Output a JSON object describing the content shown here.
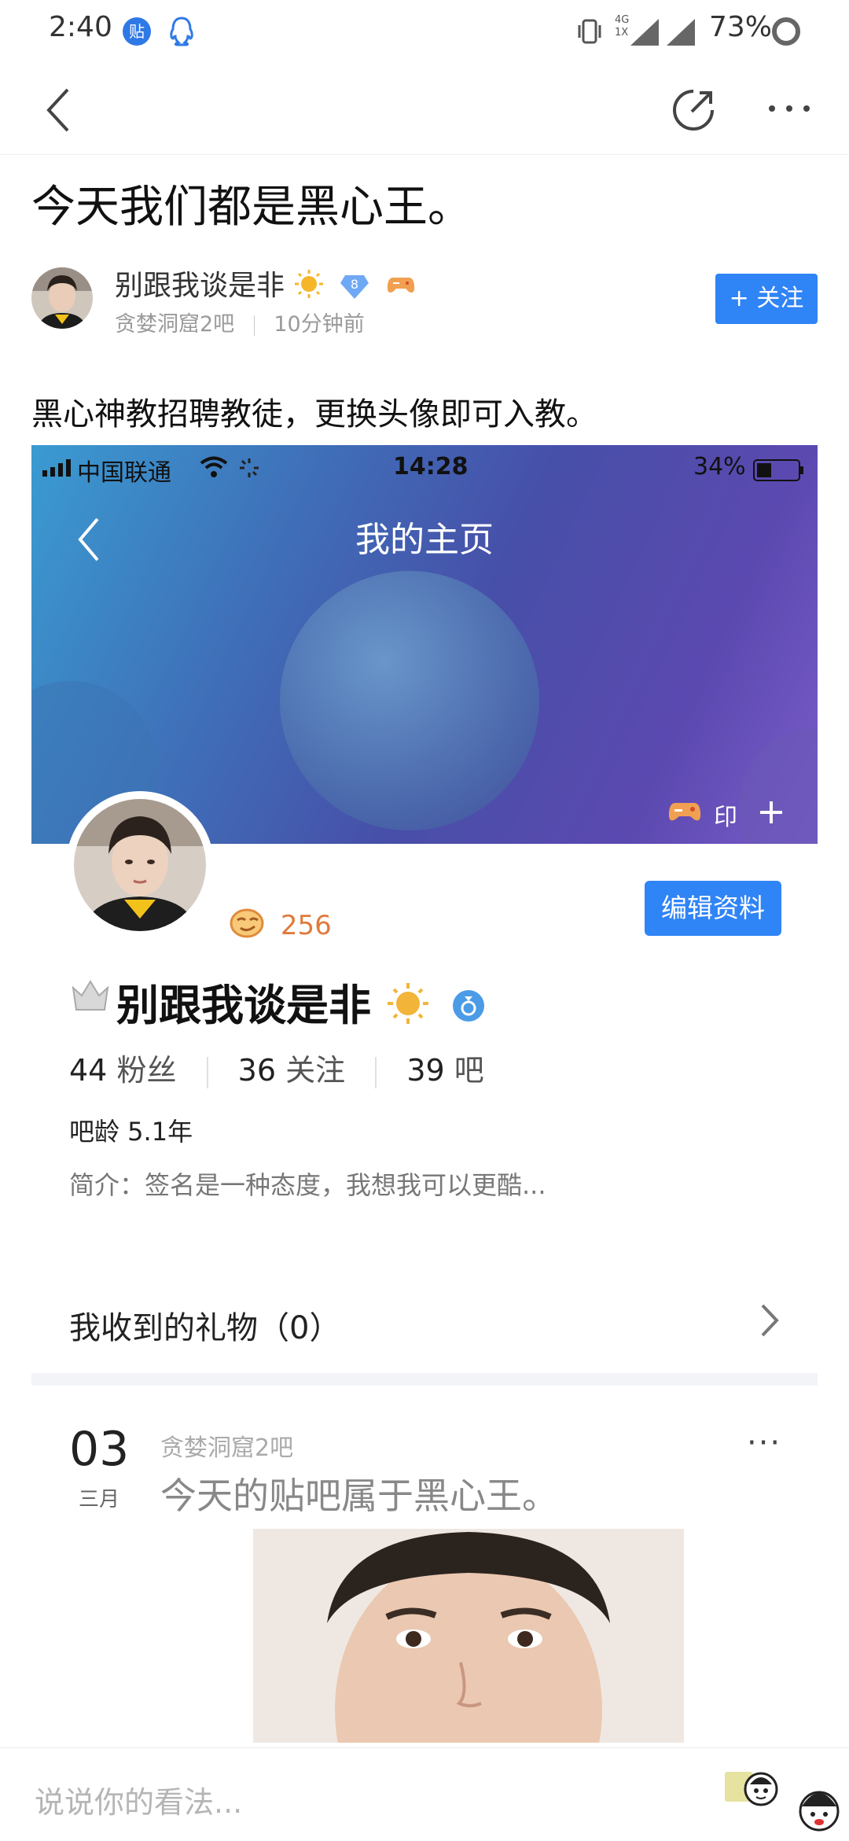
{
  "status_bar": {
    "time": "2:40",
    "tieba_badge": "贴",
    "network": "4G",
    "sim": "1X",
    "battery": "73%"
  },
  "post": {
    "title": "今天我们都是黑心王。",
    "author": {
      "name": "别跟我谈是非",
      "level_badge": "8",
      "forum": "贪婪洞窟2吧",
      "time": "10分钟前"
    },
    "follow_label": "+ 关注",
    "body": "黑心神教招聘教徒，更换头像即可入教。"
  },
  "embedded_profile": {
    "status": {
      "carrier": "中国联通",
      "time": "14:28",
      "battery": "34%"
    },
    "page_title": "我的主页",
    "action_stamp": "印",
    "level_value": "256",
    "edit_button": "编辑资料",
    "username": "别跟我谈是非",
    "stats": {
      "fans_count": "44",
      "fans_label": "粉丝",
      "follow_count": "36",
      "follow_label": "关注",
      "bars_count": "39",
      "bars_label": "吧"
    },
    "bar_age": "吧龄 5.1年",
    "intro": "简介：签名是一种态度，我想我可以更酷...",
    "gifts": "我收到的礼物（0）",
    "post": {
      "day": "03",
      "month": "三月",
      "forum": "贪婪洞窟2吧",
      "title": "今天的贴吧属于黑心王。",
      "more": "···"
    }
  },
  "comment_bar": {
    "placeholder": "说说你的看法..."
  },
  "colors": {
    "accent": "#2f84f6",
    "level_orange": "#e07a3c"
  },
  "icons": [
    "back-icon",
    "share-icon",
    "more-icon",
    "vibrate-icon",
    "signal-icon",
    "wifi-icon",
    "chevron-right-icon",
    "emoji-icon"
  ]
}
